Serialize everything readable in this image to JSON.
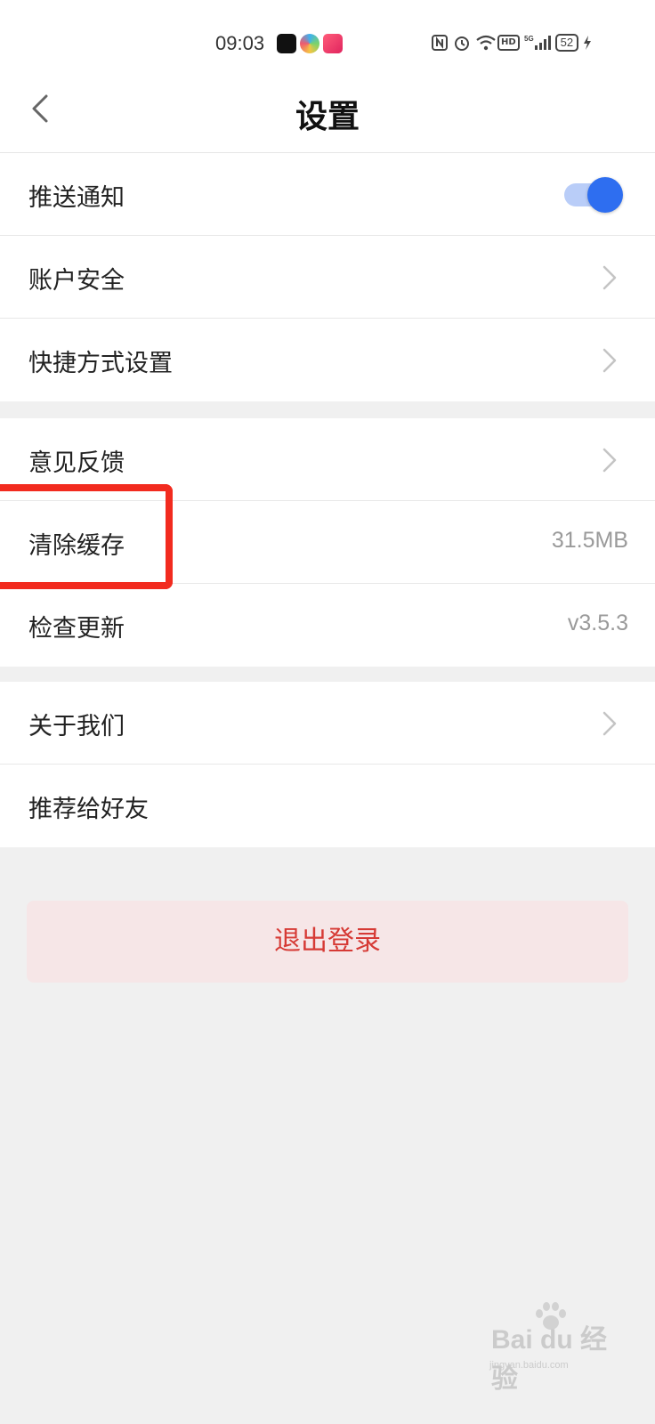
{
  "status_bar": {
    "time": "09:03",
    "network": "5G",
    "hd": "HD",
    "battery": "52"
  },
  "header": {
    "title": "设置",
    "back_icon": "chevron-left-icon"
  },
  "groups": [
    {
      "items": [
        {
          "label": "推送通知",
          "control": "toggle",
          "toggle_on": true
        },
        {
          "label": "账户安全",
          "control": "chevron"
        },
        {
          "label": "快捷方式设置",
          "control": "chevron"
        }
      ]
    },
    {
      "items": [
        {
          "label": "意见反馈",
          "control": "chevron"
        },
        {
          "label": "清除缓存",
          "control": "value",
          "value": "31.5MB"
        },
        {
          "label": "检查更新",
          "control": "value",
          "value": "v3.5.3"
        }
      ]
    },
    {
      "items": [
        {
          "label": "关于我们",
          "control": "chevron"
        },
        {
          "label": "推荐给好友",
          "control": "none"
        }
      ]
    }
  ],
  "logout": {
    "label": "退出登录"
  },
  "watermark": {
    "logo": "Bai du 经验",
    "sub": "jingyan.baidu.com"
  },
  "colors": {
    "accent": "#2e6ef0",
    "toggle_track": "#b9cdf8",
    "logout_text": "#d63a35",
    "logout_bg": "#f6e6e7",
    "highlight_box": "#f22b1f"
  }
}
